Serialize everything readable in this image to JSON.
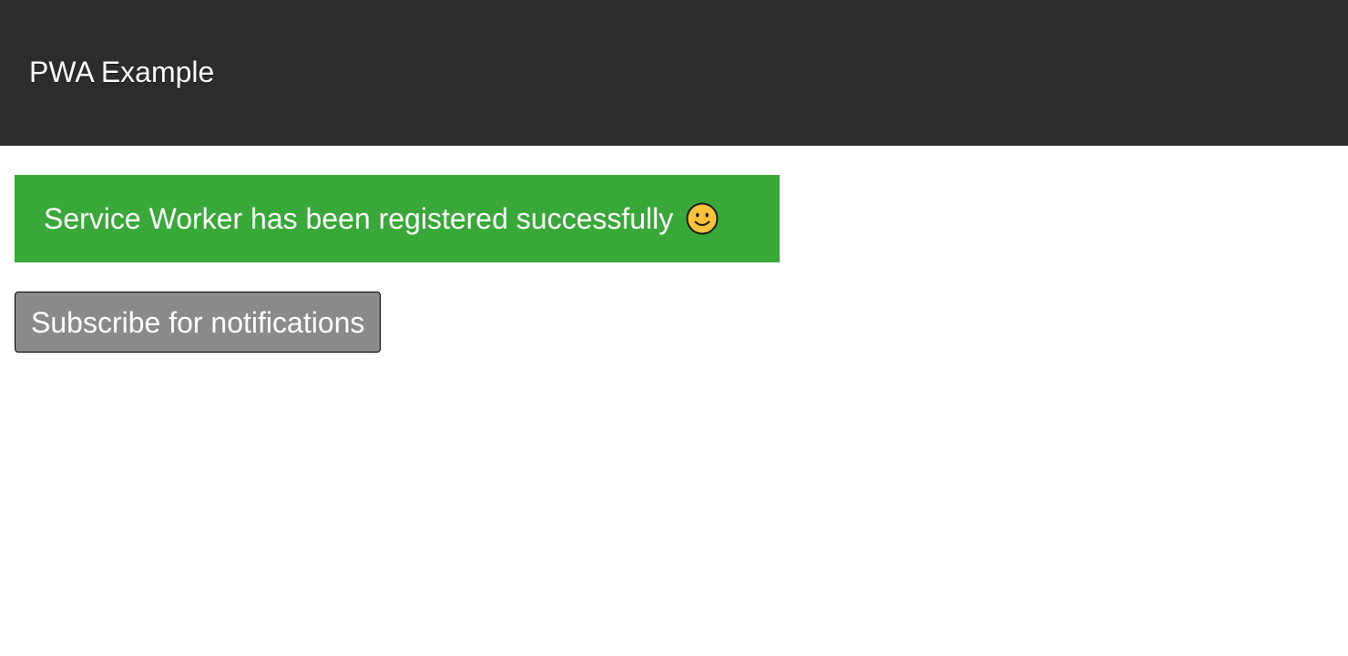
{
  "header": {
    "title": "PWA Example",
    "background_color": "#2c2c2c"
  },
  "status_banner": {
    "message": "Service Worker has been registered successfully",
    "icon": "smiley-face-icon",
    "background_color": "#38a938"
  },
  "subscribe_button": {
    "label": "Subscribe for notifications",
    "background_color": "#8a8a8a"
  }
}
